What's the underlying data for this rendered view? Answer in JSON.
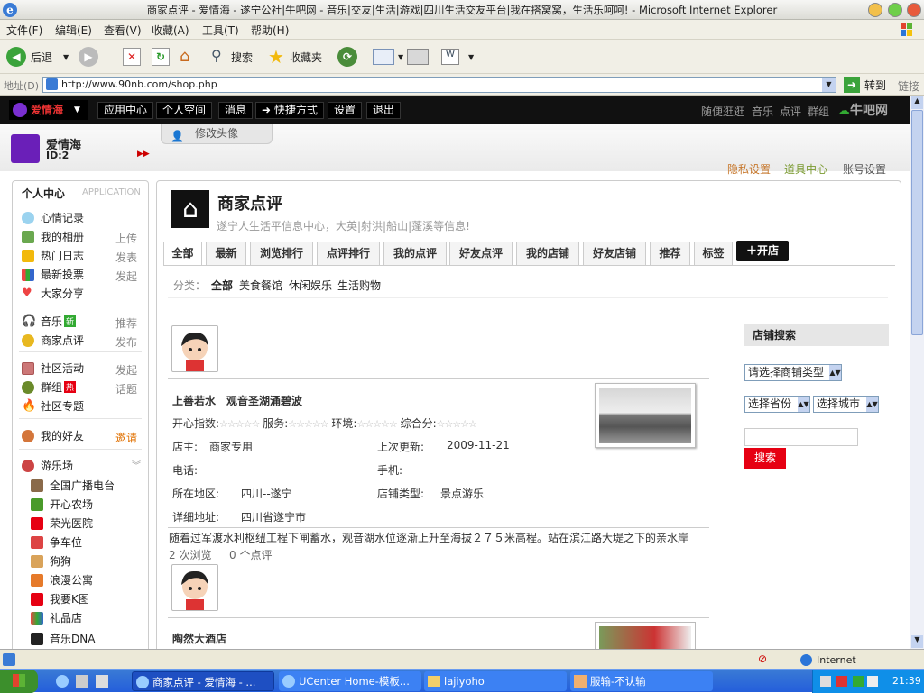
{
  "window": {
    "title": "商家点评 - 爱情海 - 遂宁公社|牛吧网 - 音乐|交友|生活|游戏|四川生活交友平台|我在搭窝窝，生活乐呵呵! - Microsoft Internet Explorer"
  },
  "menu": [
    "文件(F)",
    "编辑(E)",
    "查看(V)",
    "收藏(A)",
    "工具(T)",
    "帮助(H)"
  ],
  "toolbar": {
    "back": "后退",
    "search": "搜索",
    "favorites": "收藏夹"
  },
  "address": {
    "label": "地址(D)",
    "url": "http://www.90nb.com/shop.php",
    "go": "转到",
    "links": "链接"
  },
  "site": {
    "logo": "爱情海",
    "nav": [
      "应用中心",
      "个人空间",
      "消息",
      "快捷方式",
      "设置",
      "退出"
    ],
    "right_links": [
      "随便逛逛",
      "音乐",
      "点评",
      "群组"
    ],
    "brand": "牛吧网"
  },
  "user": {
    "name": "爱情海",
    "id": "ID:2",
    "edit_avatar": "修改头像"
  },
  "account_links": [
    "隐私设置",
    "道具中心",
    "账号设置"
  ],
  "sidebar": {
    "header": "个人中心",
    "header_en": "APPLICATION",
    "items": [
      {
        "label": "心情记录",
        "meta": ""
      },
      {
        "label": "我的相册",
        "meta": "上传"
      },
      {
        "label": "热门日志",
        "meta": "发表"
      },
      {
        "label": "最新投票",
        "meta": "发起"
      },
      {
        "label": "大家分享",
        "meta": ""
      },
      {
        "label": "音乐",
        "meta": "推荐",
        "badge": "新"
      },
      {
        "label": "商家点评",
        "meta": "发布"
      },
      {
        "label": "社区活动",
        "meta": "发起"
      },
      {
        "label": "群组",
        "meta": "话题",
        "badge": "热"
      },
      {
        "label": "社区专题",
        "meta": ""
      },
      {
        "label": "我的好友",
        "meta": "邀请"
      },
      {
        "label": "游乐场",
        "meta": ""
      }
    ],
    "games": [
      "全国广播电台",
      "开心农场",
      "荣光医院",
      "争车位",
      "狗狗",
      "浪漫公寓",
      "我要K图",
      "礼品店",
      "音乐DNA"
    ]
  },
  "main": {
    "title": "商家点评",
    "subtitle": "遂宁人生活平信息中心，大英|射洪|船山|蓬溪等信息!",
    "tabs": [
      "全部",
      "最新",
      "浏览排行",
      "点评排行",
      "我的点评",
      "好友点评",
      "我的店铺",
      "好友店铺",
      "推荐",
      "标签"
    ],
    "open_shop": "开店",
    "category_label": "分类：",
    "categories": [
      "全部",
      "美食餐馆",
      "休闲娱乐",
      "生活购物"
    ]
  },
  "shops": [
    {
      "name": "上善若水　观音圣湖涌碧波",
      "ratings": [
        "开心指数:",
        "服务:",
        "环境:",
        "综合分:"
      ],
      "owner_label": "店主:",
      "owner": "商家专用",
      "updated_label": "上次更新:",
      "updated": "2009-11-21",
      "phone_label": "电话:",
      "mobile_label": "手机:",
      "region_label": "所在地区:",
      "region": "四川--遂宁",
      "type_label": "店铺类型:",
      "type": "景点游乐",
      "address_label": "详细地址:",
      "address": "四川省遂宁市",
      "desc": "随着过军渡水利枢纽工程下闸蓄水，观音湖水位逐渐上升至海拔２７５米高程。站在滨江路大堤之下的亲水岸",
      "views": "2 次浏览",
      "reviews": "0 个点评"
    },
    {
      "name": "陶然大酒店"
    }
  ],
  "search": {
    "title": "店铺搜索",
    "type_select": "请选择商铺类型",
    "province_select": "选择省份",
    "city_select": "选择城市",
    "button": "搜索"
  },
  "status": {
    "zone": "Internet"
  },
  "taskbar": {
    "items": [
      "商家点评 - 爱情海 - ...",
      "UCenter Home-模板...",
      "lajiyoho",
      "服输-不认输"
    ],
    "clock": "21:39"
  },
  "colors": {
    "accent_red": "#e60012",
    "brand_dark": "#111111",
    "taskbar_blue": "#245edb"
  }
}
